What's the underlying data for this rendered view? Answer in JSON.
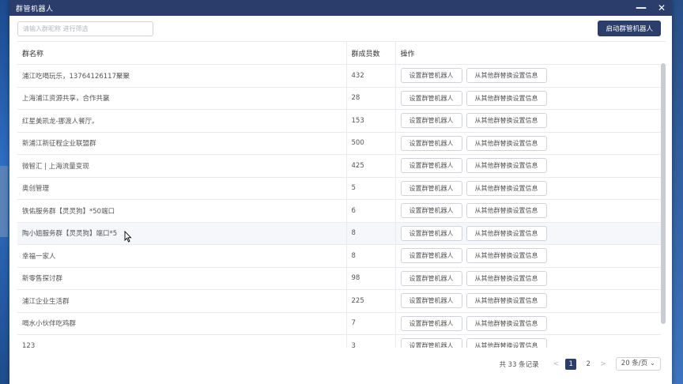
{
  "window": {
    "title": "群管机器人",
    "minimize_symbol": "—",
    "close_symbol": "✕"
  },
  "toolbar": {
    "search_placeholder": "请输入群昵称 进行筛选",
    "start_button": "启动群管机器人"
  },
  "table": {
    "headers": {
      "name": "群名称",
      "members": "群成员数",
      "actions": "操作"
    },
    "action_labels": {
      "set_bot": "设置群管机器人",
      "copy_settings": "从其他群替换设置信息"
    },
    "rows": [
      {
        "name": "浦江吃喝玩乐，13764126117聚聚",
        "members": "432"
      },
      {
        "name": "上海浦江资源共享，合作共赢",
        "members": "28"
      },
      {
        "name": "红星美凯龙-挪渡人餐厅。",
        "members": "153"
      },
      {
        "name": "新浦江新征程企业联盟群",
        "members": "500"
      },
      {
        "name": "微智汇 | 上海流量变现",
        "members": "425"
      },
      {
        "name": "奥创管理",
        "members": "5"
      },
      {
        "name": "铁佑服务群【灵灵狗】*50端口",
        "members": "6"
      },
      {
        "name": "陶小姐服务群【灵灵狗】端口*5",
        "members": "8"
      },
      {
        "name": "幸福一家人",
        "members": "8"
      },
      {
        "name": "新零售探讨群",
        "members": "98"
      },
      {
        "name": "浦江企业生活群",
        "members": "225"
      },
      {
        "name": "喝水小伙伴吃鸡群",
        "members": "7"
      },
      {
        "name": "123",
        "members": "3"
      }
    ]
  },
  "pagination": {
    "total": "共 33 条记录",
    "prev": "<",
    "pages": [
      "1",
      "2"
    ],
    "next": ">",
    "page_size": "20 条/页"
  },
  "colors": {
    "titlebar": "#2b3d6b",
    "primary_button": "#2b3d6b"
  }
}
